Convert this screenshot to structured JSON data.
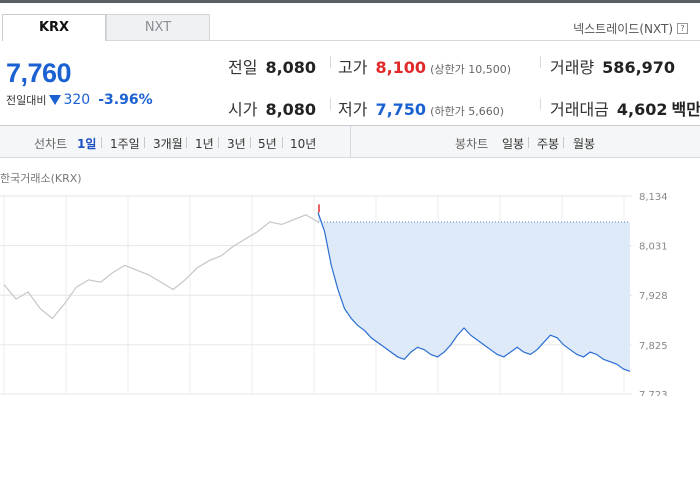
{
  "tabs": [
    {
      "label": "KRX",
      "active": true
    },
    {
      "label": "NXT",
      "active": false
    }
  ],
  "nxt_link": {
    "label": "넥스트레이드(NXT)",
    "help_icon": "?"
  },
  "quote": {
    "price": "7,760",
    "change_label": "전일대비",
    "change_direction": "down",
    "change_amount": "320",
    "change_percent": "-3.96%",
    "color": "#1b61d1"
  },
  "stats": {
    "prev_close": {
      "label": "전일",
      "value": "8,080"
    },
    "open": {
      "label": "시가",
      "value": "8,080"
    },
    "high": {
      "label": "고가",
      "value": "8,100",
      "sub": "(상한가 10,500)"
    },
    "low": {
      "label": "저가",
      "value": "7,750",
      "sub": "(하한가 5,660)"
    },
    "volume": {
      "label": "거래량",
      "value": "586,970"
    },
    "amount": {
      "label": "거래대금",
      "value": "4,602",
      "unit": "백만"
    }
  },
  "toolbar": {
    "line_label": "선차트",
    "line_periods": [
      "1일",
      "1주일",
      "3개월",
      "1년",
      "3년",
      "5년",
      "10년"
    ],
    "active_period": "1일",
    "candle_label": "봉차트",
    "candle_periods": [
      "일봉",
      "주봉",
      "월봉"
    ]
  },
  "chart": {
    "source_label": "한국거래소(KRX)",
    "y_ticks": [
      "8,134",
      "8,031",
      "7,928",
      "7,825",
      "7,723"
    ],
    "prev_close_line": 8080
  },
  "chart_data": {
    "type": "line",
    "title": "",
    "ylim": [
      7723,
      8134
    ],
    "y_ticks": [
      8134,
      8031,
      7928,
      7825,
      7723
    ],
    "grid": true,
    "series": [
      {
        "values": [
          7950,
          7920,
          7935,
          7900,
          7880,
          7910,
          7945,
          7960,
          7955,
          7975,
          7990,
          7980,
          7970,
          7955,
          7940,
          7960,
          7985,
          8000,
          8010,
          8030,
          8045,
          8060,
          8080,
          8075,
          8085,
          8095,
          8080
        ]
      },
      {
        "values": [
          8100,
          8060,
          7990,
          7940,
          7900,
          7880,
          7865,
          7855,
          7840,
          7830,
          7820,
          7810,
          7800,
          7795,
          7810,
          7820,
          7815,
          7805,
          7800,
          7810,
          7825,
          7845,
          7860,
          7845,
          7835,
          7825,
          7815,
          7805,
          7800,
          7810,
          7820,
          7810,
          7805,
          7815,
          7830,
          7845,
          7840,
          7825,
          7815,
          7805,
          7800,
          7810,
          7805,
          7795,
          7790,
          7785,
          7775,
          7770
        ]
      }
    ]
  }
}
